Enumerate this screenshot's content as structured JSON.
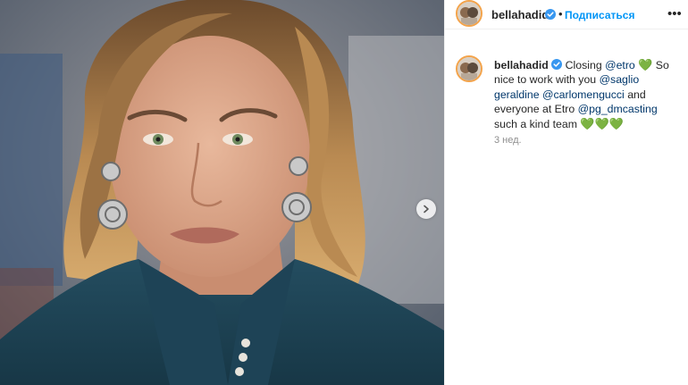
{
  "post": {
    "image_alt": "Runway portrait photo",
    "next_icon": "chevron-right-icon"
  },
  "header": {
    "username": "bellahadid",
    "verified_icon": "verified-badge-icon",
    "separator": "•",
    "follow_label": "Подписаться",
    "more_icon": "more-options-icon"
  },
  "caption": {
    "username": "bellahadid",
    "text_1": "Closing ",
    "mention_1": "@etro",
    "text_2": " So nice to work with you ",
    "mention_2": "@saglio​geraldine",
    "text_3": " ",
    "mention_3": "@carlomengucci",
    "text_4": " and everyone at Etro ",
    "mention_4": "@pg_dmcasting",
    "text_5": " such a kind team ",
    "hearts_1": "💚",
    "hearts_2": "💚💚💚",
    "time": "3 нед."
  },
  "colors": {
    "link": "#00376b",
    "follow": "#0095f6",
    "heart": "#2bc52b",
    "story_ring": "#f3a34a"
  }
}
